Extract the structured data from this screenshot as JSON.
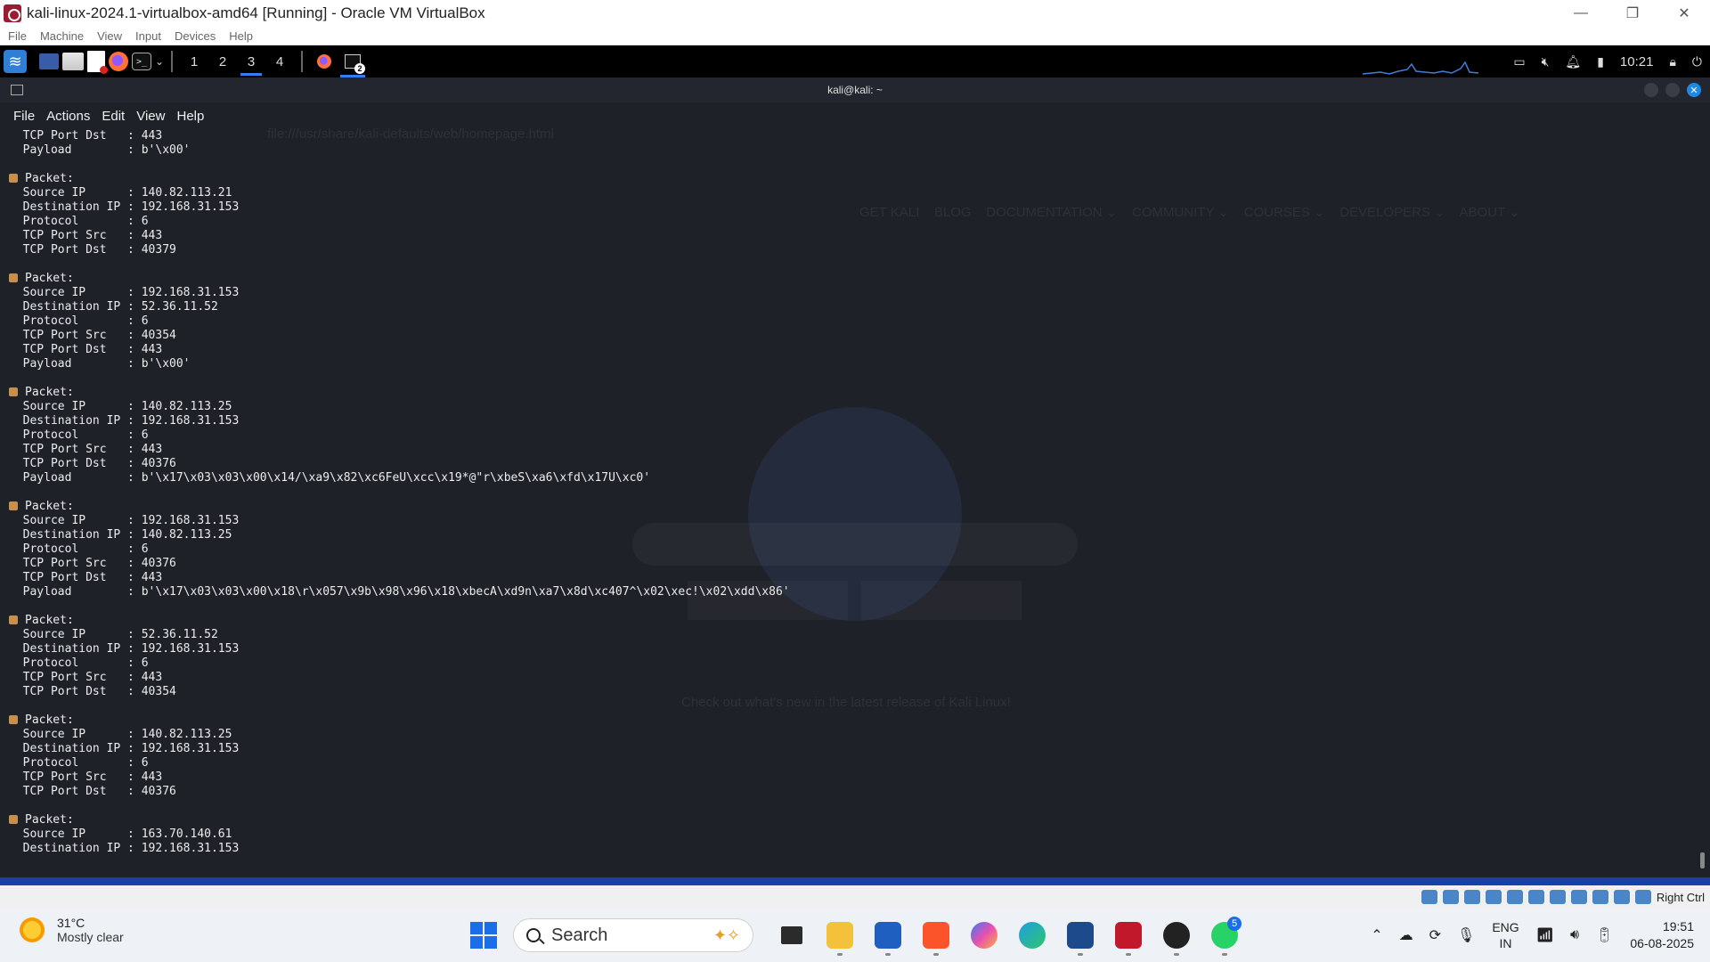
{
  "window": {
    "title": "kali-linux-2024.1-virtualbox-amd64 [Running] - Oracle VM VirtualBox",
    "controls": [
      "—",
      "❐",
      "✕"
    ]
  },
  "vbox_menu": [
    "File",
    "Machine",
    "View",
    "Input",
    "Devices",
    "Help"
  ],
  "kali_panel": {
    "workspaces": [
      "1",
      "2",
      "3",
      "4"
    ],
    "active_workspace": "3",
    "terminal_task_count": "2",
    "clock": "10:21"
  },
  "terminal": {
    "title": "kali@kali: ~",
    "menu": [
      "File",
      "Actions",
      "Edit",
      "View",
      "Help"
    ]
  },
  "background_browser_ghost": {
    "url": "file:///usr/share/kali-defaults/web/homepage.html",
    "nav": [
      "GET KALI",
      "BLOG",
      "DOCUMENTATION ⌄",
      "COMMUNITY ⌄",
      "COURSES ⌄",
      "DEVELOPERS ⌄",
      "ABOUT ⌄"
    ],
    "tagline": "Check out what's new in the latest release of Kali Linux!"
  },
  "output": {
    "head": [
      {
        "k": "TCP Port Dst",
        "v": "443"
      },
      {
        "k": "Payload",
        "v": "b'\\x00'"
      }
    ],
    "packets": [
      {
        "label": "Packet:",
        "fields": [
          {
            "k": "Source IP",
            "v": "140.82.113.21"
          },
          {
            "k": "Destination IP",
            "v": "192.168.31.153"
          },
          {
            "k": "Protocol",
            "v": "6"
          },
          {
            "k": "TCP Port Src",
            "v": "443"
          },
          {
            "k": "TCP Port Dst",
            "v": "40379"
          }
        ]
      },
      {
        "label": "Packet:",
        "fields": [
          {
            "k": "Source IP",
            "v": "192.168.31.153"
          },
          {
            "k": "Destination IP",
            "v": "52.36.11.52"
          },
          {
            "k": "Protocol",
            "v": "6"
          },
          {
            "k": "TCP Port Src",
            "v": "40354"
          },
          {
            "k": "TCP Port Dst",
            "v": "443"
          },
          {
            "k": "Payload",
            "v": "b'\\x00'"
          }
        ]
      },
      {
        "label": "Packet:",
        "fields": [
          {
            "k": "Source IP",
            "v": "140.82.113.25"
          },
          {
            "k": "Destination IP",
            "v": "192.168.31.153"
          },
          {
            "k": "Protocol",
            "v": "6"
          },
          {
            "k": "TCP Port Src",
            "v": "443"
          },
          {
            "k": "TCP Port Dst",
            "v": "40376"
          },
          {
            "k": "Payload",
            "v": "b'\\x17\\x03\\x03\\x00\\x14/\\xa9\\x82\\xc6FeU\\xcc\\x19*@\"r\\xbeS\\xa6\\xfd\\x17U\\xc0'"
          }
        ]
      },
      {
        "label": "Packet:",
        "fields": [
          {
            "k": "Source IP",
            "v": "192.168.31.153"
          },
          {
            "k": "Destination IP",
            "v": "140.82.113.25"
          },
          {
            "k": "Protocol",
            "v": "6"
          },
          {
            "k": "TCP Port Src",
            "v": "40376"
          },
          {
            "k": "TCP Port Dst",
            "v": "443"
          },
          {
            "k": "Payload",
            "v": "b'\\x17\\x03\\x03\\x00\\x18\\r\\x057\\x9b\\x98\\x96\\x18\\xbecA\\xd9n\\xa7\\x8d\\xc407^\\x02\\xec!\\x02\\xdd\\x86'"
          }
        ]
      },
      {
        "label": "Packet:",
        "fields": [
          {
            "k": "Source IP",
            "v": "52.36.11.52"
          },
          {
            "k": "Destination IP",
            "v": "192.168.31.153"
          },
          {
            "k": "Protocol",
            "v": "6"
          },
          {
            "k": "TCP Port Src",
            "v": "443"
          },
          {
            "k": "TCP Port Dst",
            "v": "40354"
          }
        ]
      },
      {
        "label": "Packet:",
        "fields": [
          {
            "k": "Source IP",
            "v": "140.82.113.25"
          },
          {
            "k": "Destination IP",
            "v": "192.168.31.153"
          },
          {
            "k": "Protocol",
            "v": "6"
          },
          {
            "k": "TCP Port Src",
            "v": "443"
          },
          {
            "k": "TCP Port Dst",
            "v": "40376"
          }
        ]
      },
      {
        "label": "Packet:",
        "fields": [
          {
            "k": "Source IP",
            "v": "163.70.140.61"
          },
          {
            "k": "Destination IP",
            "v": "192.168.31.153"
          }
        ]
      }
    ]
  },
  "vbox_status": {
    "host_key": "Right Ctrl"
  },
  "taskbar": {
    "weather_temp": "31°C",
    "weather_cond": "Mostly clear",
    "search_label": "Search",
    "whatsapp_badge": "5",
    "lang_top": "ENG",
    "lang_bottom": "IN",
    "time": "19:51",
    "date": "06-08-2025"
  }
}
